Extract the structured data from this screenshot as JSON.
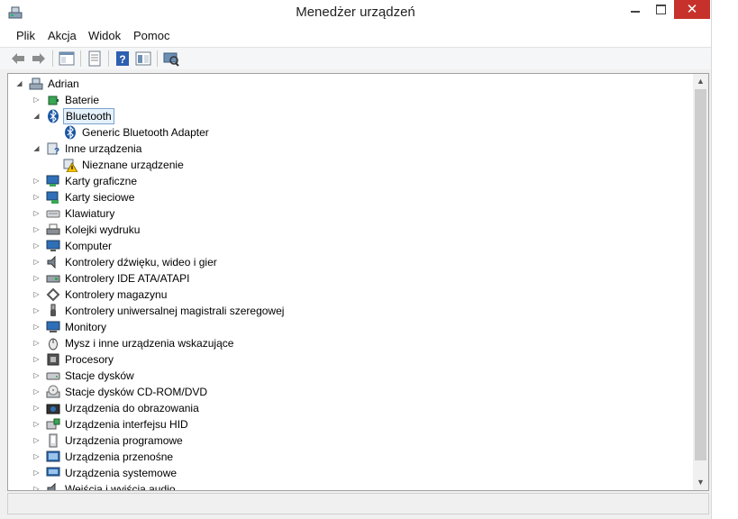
{
  "window": {
    "title": "Menedżer urządzeń",
    "close_glyph": "✕"
  },
  "menu": [
    "Plik",
    "Akcja",
    "Widok",
    "Pomoc"
  ],
  "toolbar": [
    "back-icon",
    "forward-icon",
    "console-tree-icon",
    "properties-icon",
    "help-icon",
    "view-icon",
    "scan-hardware-icon"
  ],
  "tree": {
    "root": "Adrian",
    "items": [
      {
        "label": "Baterie",
        "icon": "battery-icon",
        "level": 1,
        "state": "collapsed"
      },
      {
        "label": "Bluetooth",
        "icon": "bluetooth-icon",
        "level": 1,
        "state": "expanded",
        "selected": true
      },
      {
        "label": "Generic Bluetooth Adapter",
        "icon": "bluetooth-icon",
        "level": 2,
        "state": "leaf"
      },
      {
        "label": "Inne urządzenia",
        "icon": "unknown-device-icon",
        "level": 1,
        "state": "expanded"
      },
      {
        "label": "Nieznane urządzenie",
        "icon": "warning-device-icon",
        "level": 2,
        "state": "leaf"
      },
      {
        "label": "Karty graficzne",
        "icon": "display-adapter-icon",
        "level": 1,
        "state": "collapsed"
      },
      {
        "label": "Karty sieciowe",
        "icon": "network-adapter-icon",
        "level": 1,
        "state": "collapsed"
      },
      {
        "label": "Klawiatury",
        "icon": "keyboard-icon",
        "level": 1,
        "state": "collapsed"
      },
      {
        "label": "Kolejki wydruku",
        "icon": "printer-icon",
        "level": 1,
        "state": "collapsed"
      },
      {
        "label": "Komputer",
        "icon": "computer-icon",
        "level": 1,
        "state": "collapsed"
      },
      {
        "label": "Kontrolery dźwięku, wideo i gier",
        "icon": "speaker-icon",
        "level": 1,
        "state": "collapsed"
      },
      {
        "label": "Kontrolery IDE ATA/ATAPI",
        "icon": "ide-controller-icon",
        "level": 1,
        "state": "collapsed"
      },
      {
        "label": "Kontrolery magazynu",
        "icon": "storage-controller-icon",
        "level": 1,
        "state": "collapsed"
      },
      {
        "label": "Kontrolery uniwersalnej magistrali szeregowej",
        "icon": "usb-icon",
        "level": 1,
        "state": "collapsed"
      },
      {
        "label": "Monitory",
        "icon": "monitor-icon",
        "level": 1,
        "state": "collapsed"
      },
      {
        "label": "Mysz i inne urządzenia wskazujące",
        "icon": "mouse-icon",
        "level": 1,
        "state": "collapsed"
      },
      {
        "label": "Procesory",
        "icon": "processor-icon",
        "level": 1,
        "state": "collapsed"
      },
      {
        "label": "Stacje dysków",
        "icon": "disk-drive-icon",
        "level": 1,
        "state": "collapsed"
      },
      {
        "label": "Stacje dysków CD-ROM/DVD",
        "icon": "dvd-drive-icon",
        "level": 1,
        "state": "collapsed"
      },
      {
        "label": "Urządzenia do obrazowania",
        "icon": "camera-icon",
        "level": 1,
        "state": "collapsed"
      },
      {
        "label": "Urządzenia interfejsu HID",
        "icon": "hid-icon",
        "level": 1,
        "state": "collapsed"
      },
      {
        "label": "Urządzenia programowe",
        "icon": "software-device-icon",
        "level": 1,
        "state": "collapsed"
      },
      {
        "label": "Urządzenia przenośne",
        "icon": "portable-device-icon",
        "level": 1,
        "state": "collapsed"
      },
      {
        "label": "Urządzenia systemowe",
        "icon": "system-device-icon",
        "level": 1,
        "state": "collapsed"
      },
      {
        "label": "Wejścia i wyjścia audio",
        "icon": "audio-io-icon",
        "level": 1,
        "state": "collapsed"
      }
    ]
  },
  "colors": {
    "selection_bg": "#e5f1fb",
    "selection_border": "#7da2ce",
    "close_button": "#c7312b"
  }
}
